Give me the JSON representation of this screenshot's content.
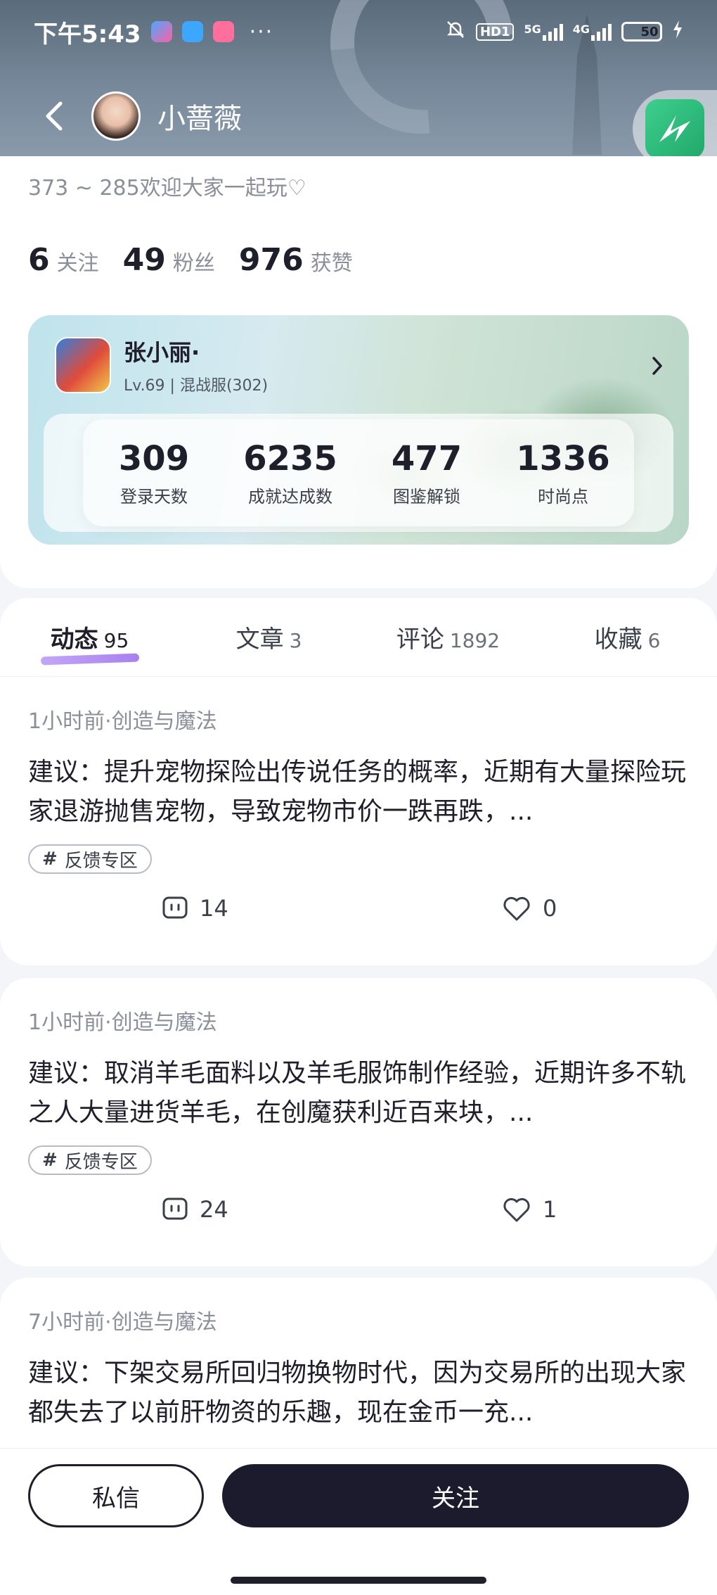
{
  "status_bar": {
    "time": "下午5:43",
    "dots": "···",
    "hd_label": "HD1",
    "net1_label": "5G",
    "net2_label": "4G",
    "battery_level": "50",
    "battery_fraction": 0.5
  },
  "header": {
    "username": "小蔷薇"
  },
  "profile": {
    "bio": "373 ~ 285欢迎大家一起玩♡",
    "stats": [
      {
        "value": "6",
        "label": "关注"
      },
      {
        "value": "49",
        "label": "粉丝"
      },
      {
        "value": "976",
        "label": "获赞"
      }
    ]
  },
  "game_card": {
    "character_name": "张小丽·",
    "subtitle": "Lv.69 | 混战服(302)",
    "stats": [
      {
        "value": "309",
        "label": "登录天数"
      },
      {
        "value": "6235",
        "label": "成就达成数"
      },
      {
        "value": "477",
        "label": "图鉴解锁"
      },
      {
        "value": "1336",
        "label": "时尚点"
      }
    ]
  },
  "tabs": [
    {
      "label": "动态",
      "count": "95",
      "active": true
    },
    {
      "label": "文章",
      "count": "3",
      "active": false
    },
    {
      "label": "评论",
      "count": "1892",
      "active": false
    },
    {
      "label": "收藏",
      "count": "6",
      "active": false
    }
  ],
  "posts": [
    {
      "meta": "1小时前·创造与魔法",
      "text": "建议：提升宠物探险出传说任务的概率，近期有大量探险玩家退游抛售宠物，导致宠物市价一跌再跌，...",
      "tag": "反馈专区",
      "comments": "14",
      "likes": "0"
    },
    {
      "meta": "1小时前·创造与魔法",
      "text": "建议：取消羊毛面料以及羊毛服饰制作经验，近期许多不轨之人大量进货羊毛，在创魔获利近百来块，...",
      "tag": "反馈专区",
      "comments": "24",
      "likes": "1"
    },
    {
      "meta": "7小时前·创造与魔法",
      "text": "建议：下架交易所回归物换物时代，因为交易所的出现大家都失去了以前肝物资的乐趣，现在金币一充..."
    }
  ],
  "bottom_bar": {
    "message_label": "私信",
    "follow_label": "关注"
  },
  "colors": {
    "accent_underline": "#a880ef",
    "follow_button": "#1c1b2e",
    "text_primary": "#1f1f2b",
    "text_secondary": "#8b8f99"
  }
}
